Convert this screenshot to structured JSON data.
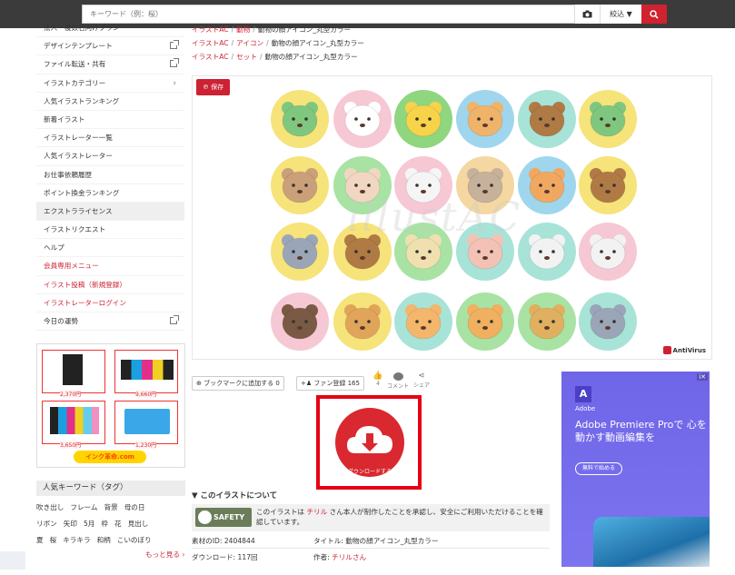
{
  "header": {
    "search_placeholder": "キーワード（例：桜）",
    "filter_label": "絞込 ▼"
  },
  "sidebar": {
    "items": [
      {
        "label": "法人・複数名向けプラン",
        "style": "normal",
        "icon": ""
      },
      {
        "label": "デザインテンプレート",
        "style": "normal",
        "icon": "external-link-icon"
      },
      {
        "label": "ファイル転送・共有",
        "style": "normal",
        "icon": "external-link-icon"
      },
      {
        "label": "イラストカテゴリー",
        "style": "normal",
        "icon": "chevron-right-icon"
      },
      {
        "label": "人気イラストランキング",
        "style": "normal",
        "icon": ""
      },
      {
        "label": "新着イラスト",
        "style": "normal",
        "icon": ""
      },
      {
        "label": "イラストレーター一覧",
        "style": "normal",
        "icon": ""
      },
      {
        "label": "人気イラストレーター",
        "style": "normal",
        "icon": ""
      },
      {
        "label": "お仕事依頼履歴",
        "style": "normal",
        "icon": ""
      },
      {
        "label": "ポイント換金ランキング",
        "style": "normal",
        "icon": ""
      },
      {
        "label": "エクストラライセンス",
        "style": "highlight",
        "icon": ""
      },
      {
        "label": "イラストリクエスト",
        "style": "normal",
        "icon": ""
      },
      {
        "label": "ヘルプ",
        "style": "normal",
        "icon": ""
      },
      {
        "label": "会員専用メニュー",
        "style": "red",
        "icon": ""
      },
      {
        "label": "イラスト投稿（新規登録）",
        "style": "red",
        "icon": ""
      },
      {
        "label": "イラストレーターログイン",
        "style": "red",
        "icon": ""
      },
      {
        "label": "今日の運勢",
        "style": "normal",
        "icon": "external-link-icon"
      }
    ]
  },
  "left_ad": {
    "prices": [
      "2,370円",
      "9,660円",
      "3,650円",
      "1,230円"
    ],
    "banner": "インク革命.com"
  },
  "keywords": {
    "title": "人気キーワード（タグ）",
    "rows": [
      [
        "吹き出し",
        "フレーム",
        "背景",
        "母の日"
      ],
      [
        "リボン",
        "矢印",
        "5月",
        "枠",
        "花",
        "見出し"
      ],
      [
        "夏",
        "桜",
        "キラキラ",
        "和柄",
        "こいのぼり"
      ]
    ],
    "more": "もっと見る ›"
  },
  "breadcrumbs": [
    {
      "parts": [
        "イラストAC",
        "動物"
      ],
      "current": "動物の顔アイコン_丸型カラー"
    },
    {
      "parts": [
        "イラストAC",
        "アイコン"
      ],
      "current": "動物の顔アイコン_丸型カラー"
    },
    {
      "parts": [
        "イラストAC",
        "セット"
      ],
      "current": "動物の顔アイコン_丸型カラー"
    }
  ],
  "preview": {
    "save_label": "保存",
    "watermark": "illustAC",
    "antivirus": "AntiVirus",
    "circle_colors": [
      [
        "#f6e37a",
        "#f6c8d4",
        "#8fd67f",
        "#9fd6ee",
        "#a8e3d8",
        "#f6e37a"
      ],
      [
        "#f6e37a",
        "#a8e3a4",
        "#f6c8d4",
        "#f5d7a2",
        "#9fd6ee",
        "#f6e37a"
      ],
      [
        "#f6e37a",
        "#f6e37a",
        "#a8e3a4",
        "#a8e3d8",
        "#a8e3d8",
        "#f6c8d4"
      ],
      [
        "#f6c8d4",
        "#f6e37a",
        "#a8e3d8",
        "#a8e3a4",
        "#a8e3a4",
        "#a8e3d8"
      ]
    ],
    "animal_colors": [
      [
        "#7fc77f",
        "#ffffff",
        "#f7d34a",
        "#f0b36a",
        "#b07a45",
        "#7fc77f"
      ],
      [
        "#c9a07a",
        "#f1d6c2",
        "#f5f5f5",
        "#c6b29a",
        "#f0a860",
        "#b07a45"
      ],
      [
        "#9aa6b8",
        "#b07a45",
        "#f0e0b0",
        "#f4c2b5",
        "#f2f2f2",
        "#f2f2f2"
      ],
      [
        "#7a5a44",
        "#e0a55a",
        "#f4b66b",
        "#f0b060",
        "#e0b060",
        "#9aa6b8"
      ]
    ]
  },
  "actions": {
    "bookmark": "ブックマークに追加する 0",
    "fan": "ファン登録 165",
    "like_count": "4",
    "comment": "コメント",
    "share": "シェア"
  },
  "download": {
    "label": "ダウンロードする"
  },
  "about": {
    "title": "▼ このイラストについて",
    "safety_badge": "SAFETY",
    "safety_pre": "このイラストは",
    "safety_author": "チリル",
    "safety_post": "さん本人が制作したことを承認し、安全にご利用いただけることを確認しています。",
    "material_id": "素材のID: 2404844",
    "title_meta": "タイトル: 動物の顔アイコン_丸型カラー",
    "downloads": "ダウンロード: 117回",
    "author_label": "作者: ",
    "author": "チリルさん"
  },
  "right_ad": {
    "logo": "A",
    "brand": "Adobe",
    "headline": "Adobe Premiere Proで 心を動かす動画編集を",
    "cta": "無料で始める"
  },
  "colors": {
    "accent": "#cc2233",
    "download_border": "#e60012",
    "topbar": "#3b3b3b"
  }
}
